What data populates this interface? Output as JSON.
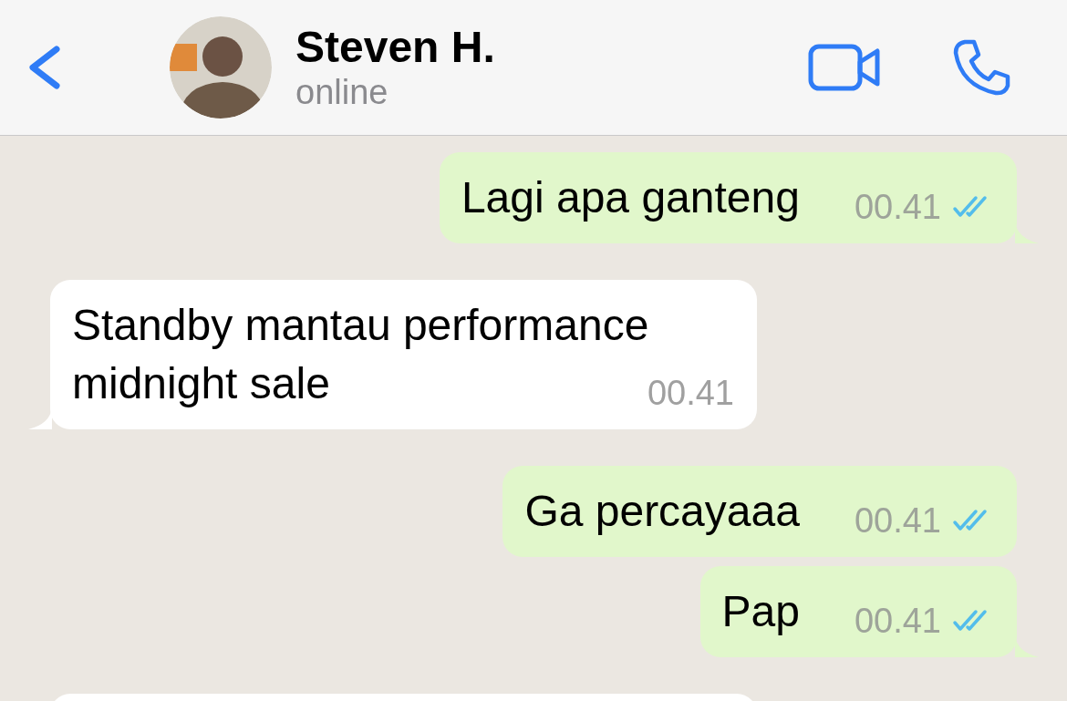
{
  "header": {
    "name": "Steven H.",
    "status": "online"
  },
  "messages": [
    {
      "kind": "outgoing",
      "text": "Lagi apa ganteng",
      "time": "00.41",
      "read": true,
      "tail": true
    },
    {
      "kind": "incoming",
      "text": "Standby mantau performance midnight sale",
      "time": "00.41",
      "tail": true
    },
    {
      "kind": "outgoing",
      "text": "Ga percayaaa",
      "time": "00.41",
      "read": true,
      "tail": false
    },
    {
      "kind": "outgoing",
      "text": "Pap",
      "time": "00.41",
      "read": true,
      "tail": true
    },
    {
      "kind": "incoming"
    }
  ]
}
